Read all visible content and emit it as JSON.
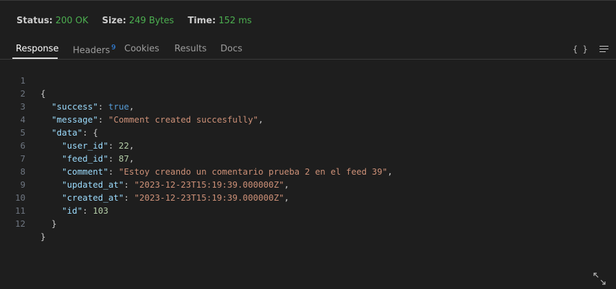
{
  "status": {
    "status_label": "Status:",
    "status_value": "200 OK",
    "size_label": "Size:",
    "size_value": "249 Bytes",
    "time_label": "Time:",
    "time_value": "152 ms"
  },
  "tabs": [
    {
      "label": "Response",
      "active": true
    },
    {
      "label": "Headers",
      "badge": "9"
    },
    {
      "label": "Cookies"
    },
    {
      "label": "Results"
    },
    {
      "label": "Docs"
    }
  ],
  "toolbar": {
    "json_icon_label": "{ }"
  },
  "lines": {
    "l1": {
      "n": "1",
      "text": "{"
    },
    "l2": {
      "n": "2",
      "key": "\"success\"",
      "sep": ": ",
      "val": "true",
      "end": ","
    },
    "l3": {
      "n": "3",
      "key": "\"message\"",
      "sep": ": ",
      "val": "\"Comment created succesfully\"",
      "end": ","
    },
    "l4": {
      "n": "4",
      "key": "\"data\"",
      "sep": ": ",
      "val": "{"
    },
    "l5": {
      "n": "5",
      "key": "\"user_id\"",
      "sep": ": ",
      "val": "22",
      "end": ","
    },
    "l6": {
      "n": "6",
      "key": "\"feed_id\"",
      "sep": ": ",
      "val": "87",
      "end": ","
    },
    "l7": {
      "n": "7",
      "key": "\"comment\"",
      "sep": ": ",
      "val": "\"Estoy creando un comentario prueba 2 en el feed 39\"",
      "end": ","
    },
    "l8": {
      "n": "8",
      "key": "\"updated_at\"",
      "sep": ": ",
      "val": "\"2023-12-23T15:19:39.000000Z\"",
      "end": ","
    },
    "l9": {
      "n": "9",
      "key": "\"created_at\"",
      "sep": ": ",
      "val": "\"2023-12-23T15:19:39.000000Z\"",
      "end": ","
    },
    "l10": {
      "n": "10",
      "key": "\"id\"",
      "sep": ": ",
      "val": "103"
    },
    "l11": {
      "n": "11",
      "text": "}"
    },
    "l12": {
      "n": "12",
      "text": "}"
    }
  }
}
